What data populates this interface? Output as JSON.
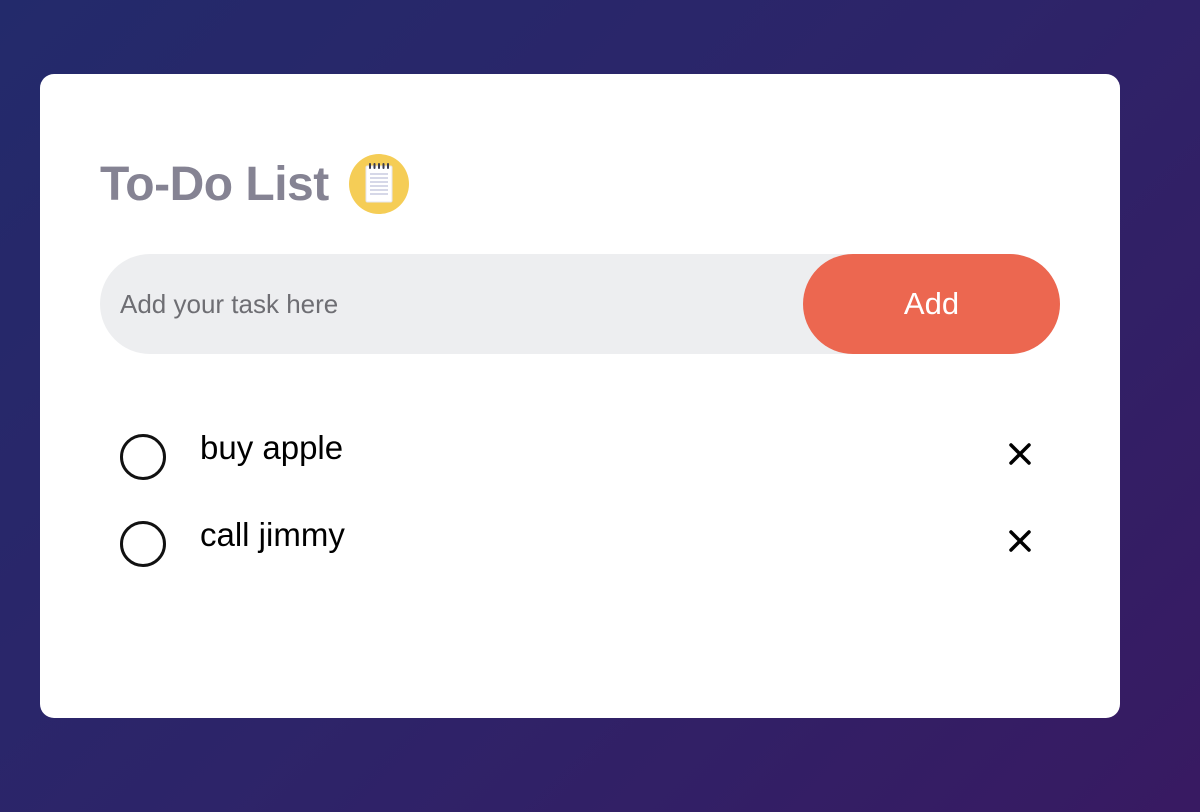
{
  "header": {
    "title": "To-Do List",
    "title_icon": "notebook-icon"
  },
  "input": {
    "placeholder": "Add your task here",
    "value": ""
  },
  "add_button": {
    "label": "Add"
  },
  "tasks": [
    {
      "text": "buy apple",
      "checked": false
    },
    {
      "text": "call jimmy",
      "checked": false
    }
  ],
  "colors": {
    "background_start": "#232a6b",
    "background_end": "#381a62",
    "card": "#ffffff",
    "title": "#858393",
    "input_bg": "#edeef0",
    "accent": "#ec6750",
    "icon_circle": "#f5cd56"
  }
}
